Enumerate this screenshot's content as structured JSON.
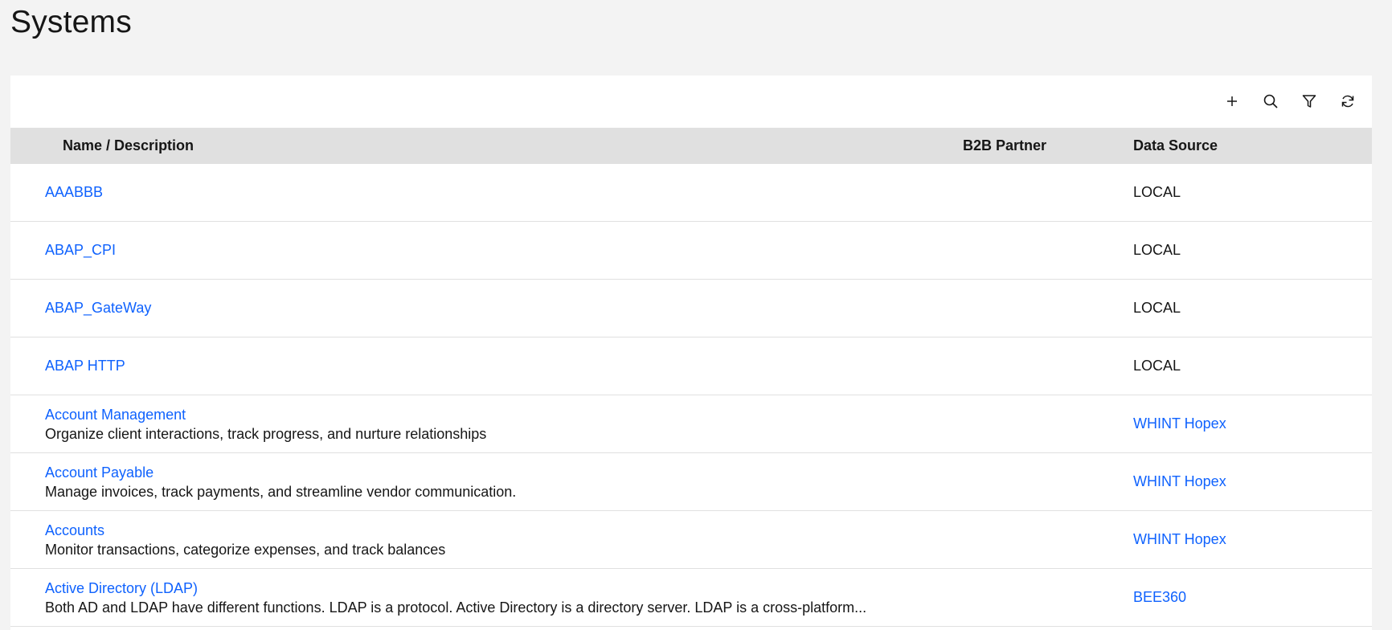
{
  "page": {
    "title": "Systems"
  },
  "toolbar": {
    "add_icon": "plus-icon",
    "search_icon": "search-icon",
    "filter_icon": "filter-icon",
    "refresh_icon": "refresh-icon"
  },
  "table": {
    "columns": {
      "name": "Name / Description",
      "b2b": "B2B Partner",
      "source": "Data Source"
    },
    "rows": [
      {
        "name": "AAABBB",
        "description": "",
        "b2b": "",
        "source": "LOCAL"
      },
      {
        "name": "ABAP_CPI",
        "description": "",
        "b2b": "",
        "source": "LOCAL"
      },
      {
        "name": "ABAP_GateWay",
        "description": "",
        "b2b": "",
        "source": "LOCAL"
      },
      {
        "name": "ABAP HTTP",
        "description": "",
        "b2b": "",
        "source": "LOCAL"
      },
      {
        "name": "Account Management",
        "description": "Organize client interactions, track progress, and nurture relationships",
        "b2b": "",
        "source": "WHINT Hopex"
      },
      {
        "name": "Account Payable",
        "description": "Manage invoices, track payments, and streamline vendor communication.",
        "b2b": "",
        "source": "WHINT Hopex"
      },
      {
        "name": "Accounts",
        "description": "Monitor transactions, categorize expenses, and track balances",
        "b2b": "",
        "source": "WHINT Hopex"
      },
      {
        "name": "Active Directory (LDAP)",
        "description": "Both AD and LDAP have different functions. LDAP is a protocol. Active Directory is a directory server. LDAP is a cross-platform...",
        "b2b": "",
        "source": "BEE360"
      }
    ]
  },
  "colors": {
    "link": "#0f62fe",
    "header_bg": "#e0e0e0",
    "page_bg": "#f3f3f3"
  }
}
